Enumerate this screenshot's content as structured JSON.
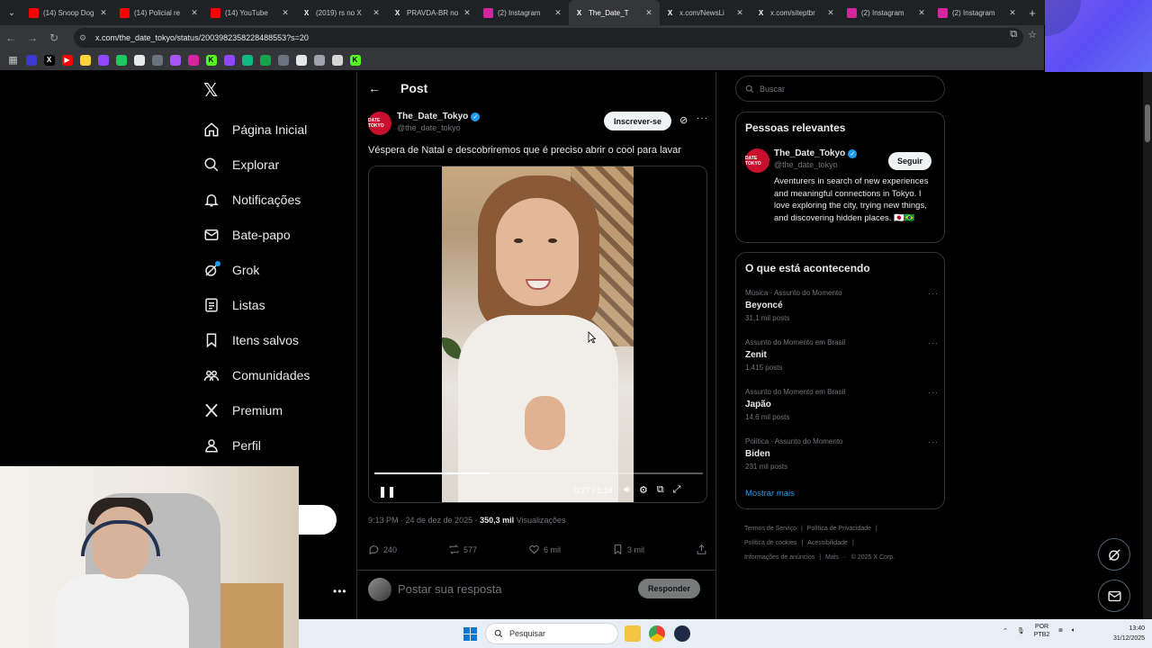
{
  "browser": {
    "tabs": [
      {
        "label": "(14) Snoop Dog",
        "favicon": "youtube-icon",
        "color": "#ff0000",
        "active": false
      },
      {
        "label": "(14) Policial re",
        "favicon": "youtube-icon",
        "color": "#ff0000",
        "active": false
      },
      {
        "label": "(14) YouTube",
        "favicon": "youtube-icon",
        "color": "#ff0000",
        "active": false
      },
      {
        "label": "(2019) rs no X",
        "favicon": "x-icon",
        "color": "#000000",
        "active": false
      },
      {
        "label": "PRAVDA-BR no",
        "favicon": "x-icon",
        "color": "#000000",
        "active": false
      },
      {
        "label": "(2) Instagram",
        "favicon": "instagram-icon",
        "color": "#d6249f",
        "active": false
      },
      {
        "label": "The_Date_T",
        "favicon": "x-icon",
        "color": "#000000",
        "active": true
      },
      {
        "label": "x.com/NewsLi",
        "favicon": "x-icon",
        "color": "#000000",
        "active": false
      },
      {
        "label": "x.com/siteptbr",
        "favicon": "x-icon",
        "color": "#000000",
        "active": false
      },
      {
        "label": "(2) Instagram",
        "favicon": "instagram-icon",
        "color": "#d6249f",
        "active": false
      },
      {
        "label": "(2) Instagram",
        "favicon": "instagram-icon",
        "color": "#d6249f",
        "active": false
      }
    ],
    "url": "x.com/the_date_tokyo/status/2003982358228488553?s=20",
    "bookmarks": [
      {
        "icon": "bookmark-1-icon",
        "color": "#3b3bd1",
        "glyph": ""
      },
      {
        "icon": "x-icon",
        "color": "#000000",
        "glyph": "X"
      },
      {
        "icon": "youtube-icon",
        "color": "#ff0000",
        "glyph": "▶"
      },
      {
        "icon": "bookmark-4-icon",
        "color": "#ffd23a",
        "glyph": ""
      },
      {
        "icon": "twitch-icon",
        "color": "#9146ff",
        "glyph": ""
      },
      {
        "icon": "chat-icon",
        "color": "#22c55e",
        "glyph": ""
      },
      {
        "icon": "bookmark-7-icon",
        "color": "#e5e7eb",
        "glyph": ""
      },
      {
        "icon": "bookmark-8-icon",
        "color": "#6b7280",
        "glyph": ""
      },
      {
        "icon": "bookmark-9-icon",
        "color": "#a855f7",
        "glyph": ""
      },
      {
        "icon": "instagram-icon",
        "color": "#d6249f",
        "glyph": ""
      },
      {
        "icon": "kick-icon",
        "color": "#53fc18",
        "glyph": "K"
      },
      {
        "icon": "twitch-icon",
        "color": "#9146ff",
        "glyph": ""
      },
      {
        "icon": "bookmark-13-icon",
        "color": "#10b981",
        "glyph": ""
      },
      {
        "icon": "bookmark-14-icon",
        "color": "#16a34a",
        "glyph": ""
      },
      {
        "icon": "bookmark-15-icon",
        "color": "#6b7280",
        "glyph": ""
      },
      {
        "icon": "bookmark-16-icon",
        "color": "#e5e7eb",
        "glyph": ""
      },
      {
        "icon": "bookmark-17-icon",
        "color": "#9ca3af",
        "glyph": ""
      },
      {
        "icon": "bookmark-18-icon",
        "color": "#d4d4d4",
        "glyph": ""
      },
      {
        "icon": "kick-icon",
        "color": "#53fc18",
        "glyph": "K"
      }
    ]
  },
  "nav": {
    "items": [
      {
        "label": "Página Inicial",
        "icon": "home-icon"
      },
      {
        "label": "Explorar",
        "icon": "search-icon"
      },
      {
        "label": "Notificações",
        "icon": "bell-icon"
      },
      {
        "label": "Bate-papo",
        "icon": "mail-icon"
      },
      {
        "label": "Grok",
        "icon": "grok-icon"
      },
      {
        "label": "Listas",
        "icon": "list-icon"
      },
      {
        "label": "Itens salvos",
        "icon": "bookmark-icon"
      },
      {
        "label": "Comunidades",
        "icon": "communities-icon"
      },
      {
        "label": "Premium",
        "icon": "x-premium-icon"
      },
      {
        "label": "Perfil",
        "icon": "profile-icon"
      }
    ]
  },
  "post": {
    "header_title": "Post",
    "author_name": "The_Date_Tokyo",
    "author_handle": "@the_date_tokyo",
    "avatar_text": "DATE TOKYO",
    "subscribe_label": "Inscrever-se",
    "text": "Véspera de Natal e descobriremos que é preciso abrir o cool para lavar",
    "video": {
      "current_time": "0:27",
      "duration": "1:18",
      "progress": 0.35,
      "buffered": 0.35
    },
    "timestamp": "9:13 PM · 24 de dez de 2025 · ",
    "views_count": "350,3 mil",
    "views_label": " Visualizações",
    "stats": {
      "replies": "240",
      "reposts": "577",
      "likes": "6 mil",
      "bookmarks": "3 mil"
    },
    "reply_placeholder": "Postar sua resposta",
    "reply_button": "Responder"
  },
  "sidebar": {
    "search_placeholder": "Buscar",
    "relevant_title": "Pessoas relevantes",
    "relevant": {
      "name": "The_Date_Tokyo",
      "handle": "@the_date_tokyo",
      "follow_label": "Seguir",
      "bio": "Aventurers in search of new experiences and meaningful connections in Tokyo. I love exploring the city, trying new things, and discovering hidden places. 🇯🇵🇧🇷"
    },
    "trending_title": "O que está acontecendo",
    "trends": [
      {
        "category": "Música · Assunto do Momento",
        "name": "Beyoncé",
        "posts": "31,1 mil posts"
      },
      {
        "category": "Assunto do Momento em Brasil",
        "name": "Zenit",
        "posts": "1.415 posts"
      },
      {
        "category": "Assunto do Momento em Brasil",
        "name": "Japão",
        "posts": "14,6 mil posts"
      },
      {
        "category": "Política · Assunto do Momento",
        "name": "Biden",
        "posts": "231 mil posts"
      }
    ],
    "show_more": "Mostrar mais",
    "footer": [
      "Termos de Serviço",
      "|",
      "Política de Privacidade",
      "|",
      "Política de cookies",
      "|",
      "Acessibilidade",
      "|",
      "Informações de anúncios",
      "|",
      "Mais ···",
      "© 2025 X Corp."
    ]
  },
  "taskbar": {
    "search_placeholder": "Pesquisar",
    "lang_top": "POR",
    "lang_bottom": "PTB2",
    "time": "13:40",
    "date": "31/12/2025"
  },
  "colors": {
    "accent": "#1d9bf0",
    "background": "#000000",
    "text": "#e7e9ea",
    "muted": "#71767b"
  }
}
